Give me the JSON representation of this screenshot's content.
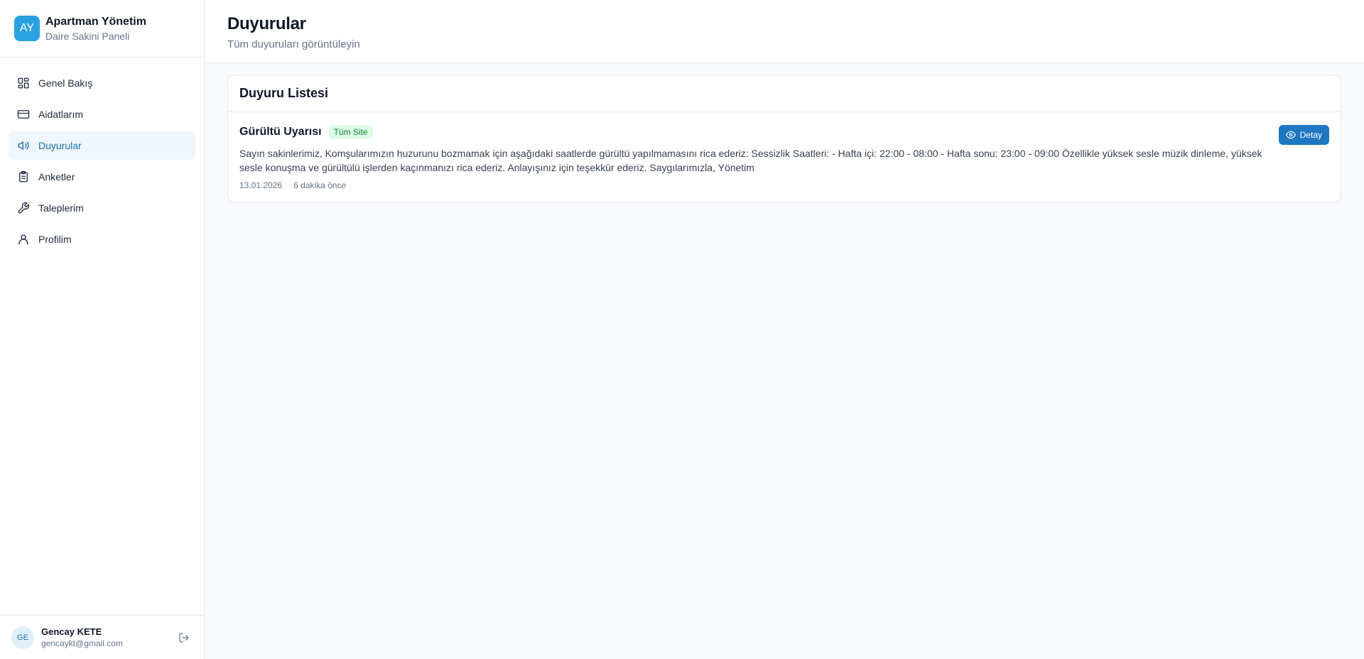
{
  "brand": {
    "initials": "AY",
    "title": "Apartman Yönetim",
    "subtitle": "Daire Sakini Paneli",
    "accent": "#29a3e0"
  },
  "sidebar": {
    "items": [
      {
        "label": "Genel Bakış",
        "icon": "grid-icon",
        "active": false
      },
      {
        "label": "Aidatlarım",
        "icon": "credit-card-icon",
        "active": false
      },
      {
        "label": "Duyurular",
        "icon": "megaphone-icon",
        "active": true
      },
      {
        "label": "Anketler",
        "icon": "clipboard-icon",
        "active": false
      },
      {
        "label": "Taleplerim",
        "icon": "wrench-icon",
        "active": false
      },
      {
        "label": "Profilim",
        "icon": "user-icon",
        "active": false
      }
    ]
  },
  "user": {
    "initials": "GE",
    "name": "Gencay KETE",
    "email": "gencaykt@gmail.com"
  },
  "header": {
    "title": "Duyurular",
    "subtitle": "Tüm duyuruları görüntüleyin"
  },
  "list": {
    "title": "Duyuru Listesi",
    "announcements": [
      {
        "title": "Gürültü Uyarısı",
        "badge": "Tüm Site",
        "text": "Sayın sakinlerimiz, Komşularımızın huzurunu bozmamak için aşağıdaki saatlerde gürültü yapılmamasını rica ederiz: Sessizlik Saatleri: - Hafta içi: 22:00 - 08:00 - Hafta sonu: 23:00 - 09:00 Özellikle yüksek sesle müzik dinleme, yüksek sesle konuşma ve gürültülü işlerden kaçınmanızı rica ederiz. Anlayışınız için teşekkür ederiz. Saygılarımızla, Yönetim",
        "date": "13.01.2026",
        "relative": "6 dakika önce",
        "button": "Detay"
      }
    ]
  }
}
